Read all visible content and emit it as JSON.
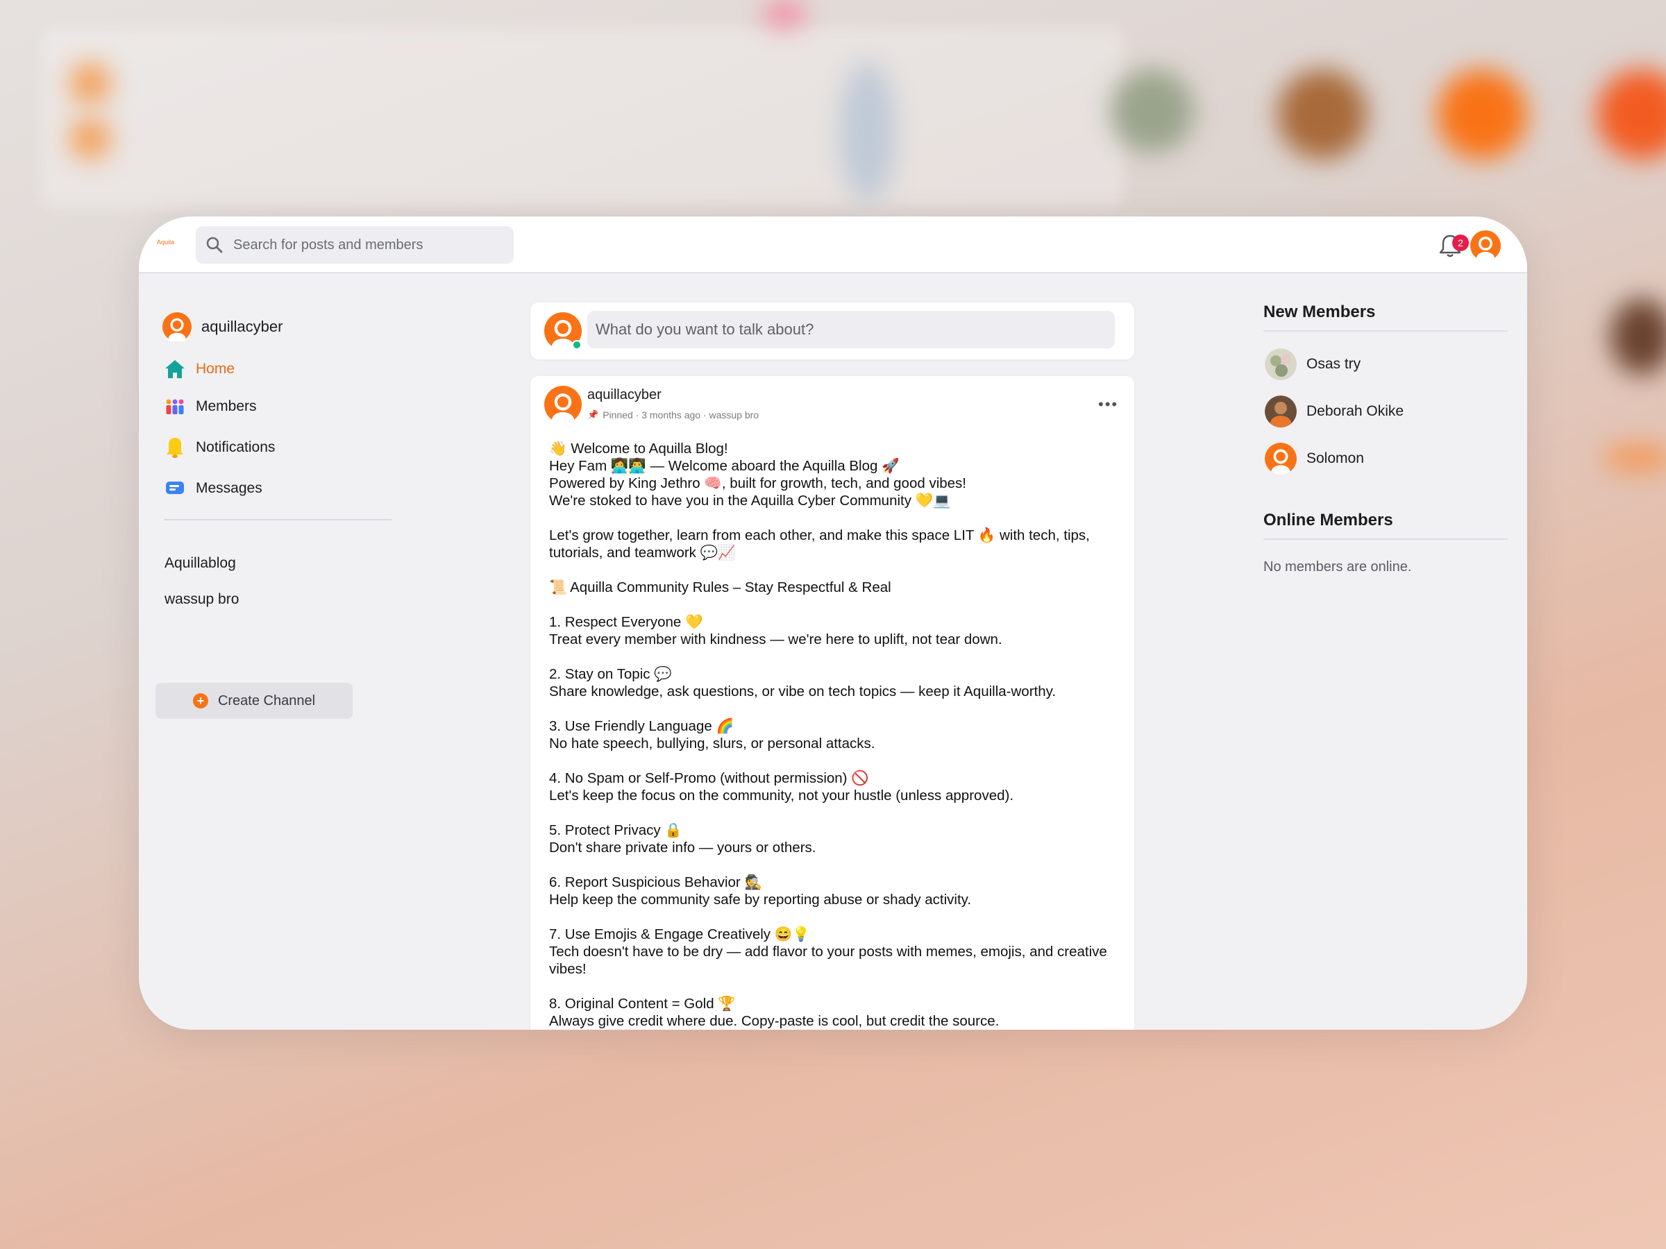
{
  "app": {
    "logo_text": "Aquila"
  },
  "search": {
    "placeholder": "Search for posts and members"
  },
  "notifications": {
    "count": "2"
  },
  "sidebar": {
    "username": "aquillacyber",
    "nav": [
      {
        "label": "Home"
      },
      {
        "label": "Members"
      },
      {
        "label": "Notifications"
      },
      {
        "label": "Messages"
      }
    ],
    "channels": [
      "Aquillablog",
      "wassup bro"
    ],
    "create_channel_label": "Create Channel"
  },
  "composer": {
    "placeholder": "What do you want to talk about?"
  },
  "post": {
    "author": "aquillacyber",
    "meta": "Pinned · 3 months ago · wassup bro",
    "lines": [
      "👋 Welcome to Aquilla Blog!",
      "Hey Fam 👩‍💻👨‍💻 — Welcome aboard the Aquilla Blog 🚀",
      "Powered by King Jethro 🧠, built for growth, tech, and good vibes!",
      "We're stoked to have you in the Aquilla Cyber Community 💛💻",
      "",
      "Let's grow together, learn from each other, and make this space LIT 🔥 with tech, tips, tutorials, and teamwork 💬📈",
      "",
      "📜 Aquilla Community Rules – Stay Respectful & Real",
      "",
      "1. Respect Everyone 💛",
      "Treat every member with kindness — we're here to uplift, not tear down.",
      "",
      "2. Stay on Topic 💬",
      "Share knowledge, ask questions, or vibe on tech topics — keep it Aquilla-worthy.",
      "",
      "3. Use Friendly Language 🌈",
      "No hate speech, bullying, slurs, or personal attacks.",
      "",
      "4. No Spam or Self-Promo (without permission) 🚫",
      "Let's keep the focus on the community, not your hustle (unless approved).",
      "",
      "5. Protect Privacy 🔒",
      "Don't share private info — yours or others.",
      "",
      "6. Report Suspicious Behavior 🕵️",
      "Help keep the community safe by reporting abuse or shady activity.",
      "",
      "7. Use Emojis & Engage Creatively 😄💡",
      "Tech doesn't have to be dry — add flavor to your posts with memes, emojis, and creative vibes!",
      "",
      "8. Original Content = Gold 🏆",
      "Always give credit where due. Copy-paste is cool, but credit the source."
    ]
  },
  "new_members": {
    "title": "New Members",
    "items": [
      {
        "name": "Osas try"
      },
      {
        "name": "Deborah Okike"
      },
      {
        "name": "Solomon"
      }
    ]
  },
  "online_members": {
    "title": "Online Members",
    "empty_text": "No members are online."
  },
  "colors": {
    "accent": "#f97316",
    "badge": "#e51d4b",
    "online": "#10b981"
  },
  "icons": [
    "search-icon",
    "bell-icon",
    "user-avatar-icon",
    "home-icon",
    "members-icon",
    "notifications-icon",
    "messages-icon",
    "plus-icon",
    "pin-icon",
    "more-icon"
  ]
}
